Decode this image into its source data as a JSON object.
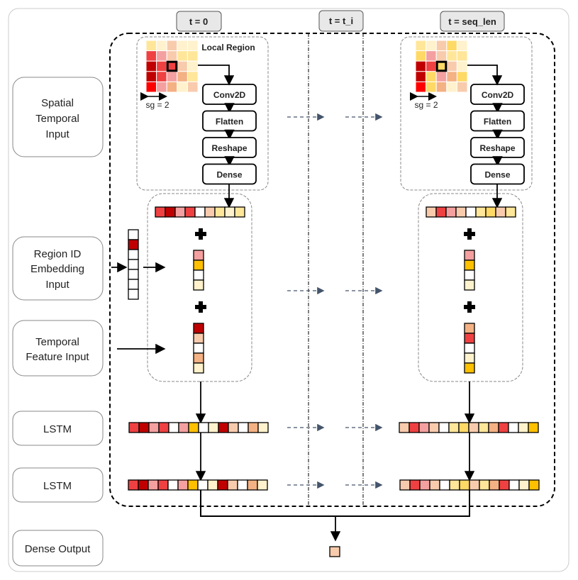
{
  "headers": [
    "t = 0",
    "t = t_i",
    "t = seq_len"
  ],
  "inputs": {
    "spatial": [
      "Spatial",
      "Temporal",
      "Input"
    ],
    "region": [
      "Region ID",
      "Embedding",
      "Input"
    ],
    "temporal": [
      "Temporal",
      "Feature Input"
    ],
    "lstm1": "LSTM",
    "lstm2": "LSTM",
    "dense_output": "Dense Output"
  },
  "local_region_label": "Local Region",
  "sg_label": "sg = 2",
  "ops": [
    "Conv2D",
    "Flatten",
    "Reshape",
    "Dense"
  ],
  "palette": {
    "D": "#c00000",
    "R": "#ef4141",
    "B": "#ff0000",
    "P": "#f4a0a0",
    "C": "#f8cbad",
    "O": "#f4b183",
    "Y": "#ffe699",
    "G": "#ffd966",
    "A": "#ffc000",
    "L": "#fff2cc",
    "W": "#ffffff"
  },
  "grids": {
    "t0": [
      "YLCLL",
      "RPCYY",
      "DRRCL",
      "DRPOY",
      "BPOLC"
    ],
    "tseq": [
      "YLCGL",
      "GPCYY",
      "DRGCL",
      "DGPOG",
      "BGOLC"
    ]
  },
  "vectors": {
    "t0_flat": "RDPRWCYLY",
    "t0_region": "PAWL",
    "t0_temporal": "DCWOL",
    "region_input": "WDWWWWW",
    "tseq_flat": "CRPCWYGCY",
    "tseq_region": "PAWL",
    "tseq_temporal": "ORWLA",
    "t0_lstm1": "RDPRWPAWLDCWOL",
    "t0_lstm2": "RDPRWPAWLDCWOL",
    "tseq_lstm1": "CRPCWYGCYORWLA",
    "tseq_lstm2": "CRPCWYGCYORWLA",
    "output": "C"
  },
  "arrow_color": "#44546a"
}
